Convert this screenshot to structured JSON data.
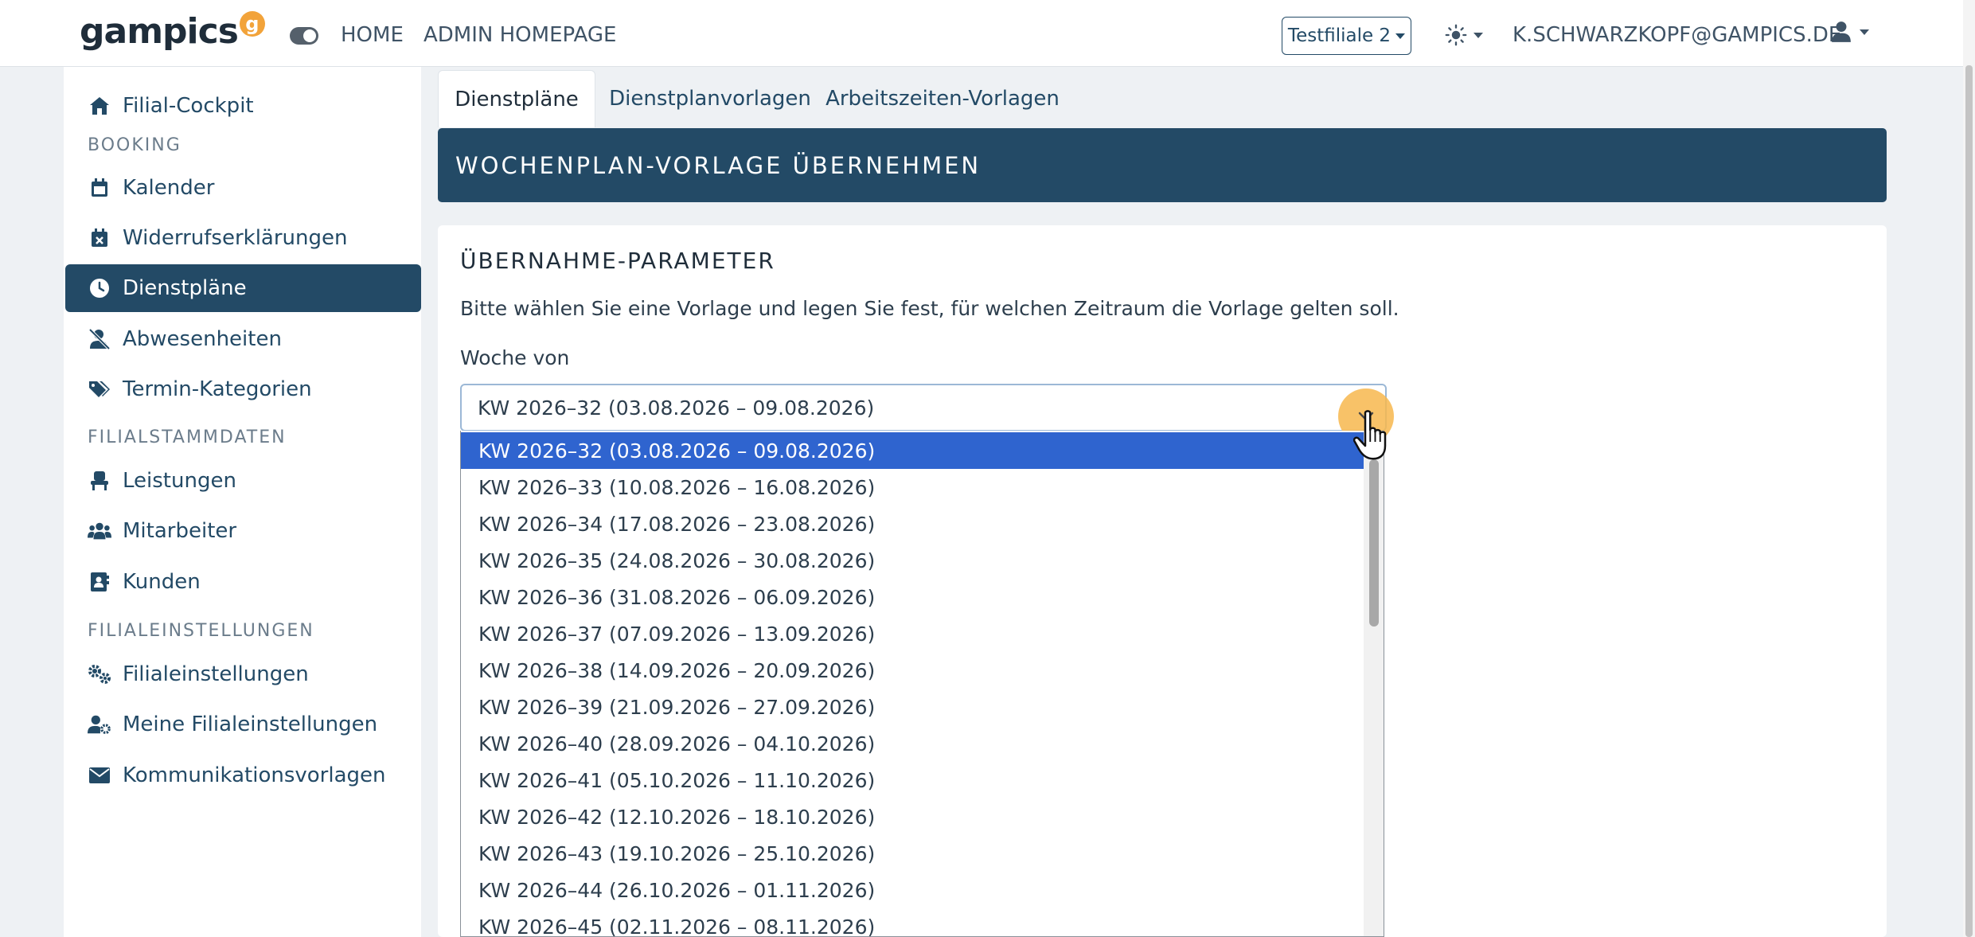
{
  "brand": {
    "name": "gampics",
    "badge": "g"
  },
  "topnav": {
    "links": [
      "HOME",
      "ADMIN HOMEPAGE"
    ],
    "branch": "Testfiliale 2",
    "user_email": "K.SCHWARZKOPF@GAMPICS.DE"
  },
  "sidebar": {
    "cockpit": "Filial-Cockpit",
    "booking_header": "BOOKING",
    "booking": [
      "Kalender",
      "Widerrufserklärungen",
      "Dienstpläne",
      "Abwesenheiten",
      "Termin-Kategorien"
    ],
    "stamm_header": "FILIALSTAMMDATEN",
    "stamm": [
      "Leistungen",
      "Mitarbeiter",
      "Kunden"
    ],
    "settings_header": "FILIALEINSTELLUNGEN",
    "settings": [
      "Filialeinstellungen",
      "Meine Filialeinstellungen",
      "Kommunikationsvorlagen"
    ]
  },
  "tabs": [
    "Dienstpläne",
    "Dienstplanvorlagen",
    "Arbeitszeiten-Vorlagen"
  ],
  "banner_title": "WOCHENPLAN-VORLAGE ÜBERNEHMEN",
  "card": {
    "title": "ÜBERNAHME-PARAMETER",
    "description": "Bitte wählen Sie eine Vorlage und legen Sie fest, für welchen Zeitraum die Vorlage gelten soll.",
    "field_label": "Woche von",
    "selected_value": "KW 2026–32 (03.08.2026 – 09.08.2026)"
  },
  "dropdown_options": [
    "KW 2026–32 (03.08.2026 – 09.08.2026)",
    "KW 2026–33 (10.08.2026 – 16.08.2026)",
    "KW 2026–34 (17.08.2026 – 23.08.2026)",
    "KW 2026–35 (24.08.2026 – 30.08.2026)",
    "KW 2026–36 (31.08.2026 – 06.09.2026)",
    "KW 2026–37 (07.09.2026 – 13.09.2026)",
    "KW 2026–38 (14.09.2026 – 20.09.2026)",
    "KW 2026–39 (21.09.2026 – 27.09.2026)",
    "KW 2026–40 (28.09.2026 – 04.10.2026)",
    "KW 2026–41 (05.10.2026 – 11.10.2026)",
    "KW 2026–42 (12.10.2026 – 18.10.2026)",
    "KW 2026–43 (19.10.2026 – 25.10.2026)",
    "KW 2026–44 (26.10.2026 – 01.11.2026)",
    "KW 2026–45 (02.11.2026 – 08.11.2026)"
  ],
  "colors": {
    "primary": "#234a66",
    "accent": "#f2a33a",
    "selected_option": "#2f64cf"
  }
}
